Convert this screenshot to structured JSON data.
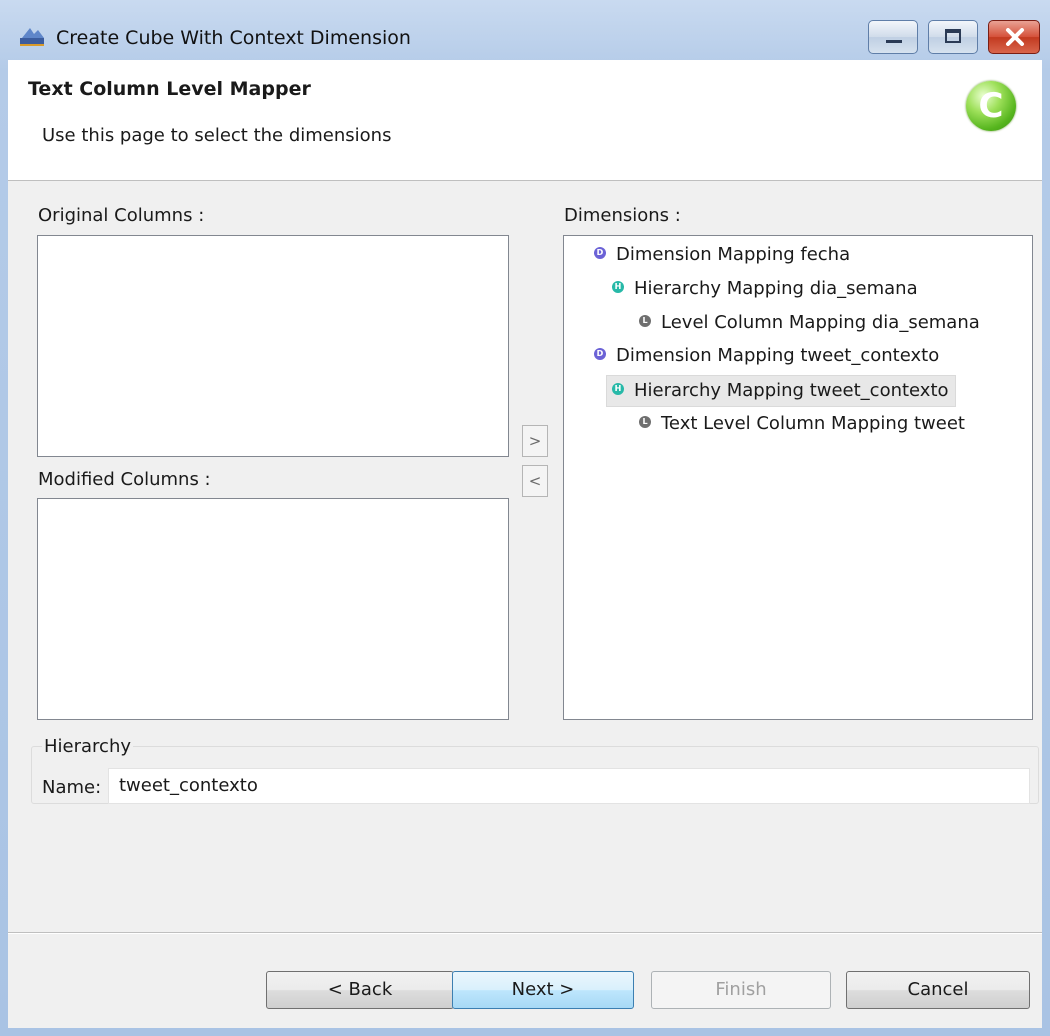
{
  "window": {
    "title": "Create Cube With Context Dimension",
    "controls": [
      "minimize",
      "maximize",
      "close"
    ]
  },
  "header": {
    "title": "Text Column Level Mapper",
    "description": "Use this page to select the dimensions",
    "logo_letter": "C"
  },
  "original_columns": {
    "label": "Original Columns :",
    "items": []
  },
  "modified_columns": {
    "label": "Modified Columns :",
    "items": []
  },
  "move_buttons": {
    "add": ">",
    "remove": "<"
  },
  "dimensions": {
    "label": "Dimensions :",
    "tree": [
      {
        "type": "dimension",
        "label": "Dimension Mapping fecha",
        "icon": "dimension-icon"
      },
      {
        "type": "hierarchy",
        "label": "Hierarchy Mapping dia_semana",
        "icon": "hierarchy-icon"
      },
      {
        "type": "level",
        "label": "Level Column Mapping dia_semana",
        "icon": "level-icon"
      },
      {
        "type": "dimension",
        "label": "Dimension Mapping tweet_contexto",
        "icon": "dimension-icon"
      },
      {
        "type": "hierarchy",
        "label": "Hierarchy Mapping tweet_contexto",
        "icon": "hierarchy-icon",
        "selected": true
      },
      {
        "type": "level",
        "label": "Text Level Column Mapping tweet",
        "icon": "level-icon"
      }
    ]
  },
  "hierarchy": {
    "group_label": "Hierarchy",
    "name_label": "Name:",
    "name_value": "tweet_contexto"
  },
  "footer": {
    "back": "< Back",
    "next": "Next >",
    "finish": "Finish",
    "cancel": "Cancel",
    "finish_enabled": false
  },
  "colors": {
    "dimension_icon": "#6b62d6",
    "hierarchy_icon": "#27b9a8",
    "level_icon": "#6f6f6f",
    "selection": "#e8e8e8"
  }
}
